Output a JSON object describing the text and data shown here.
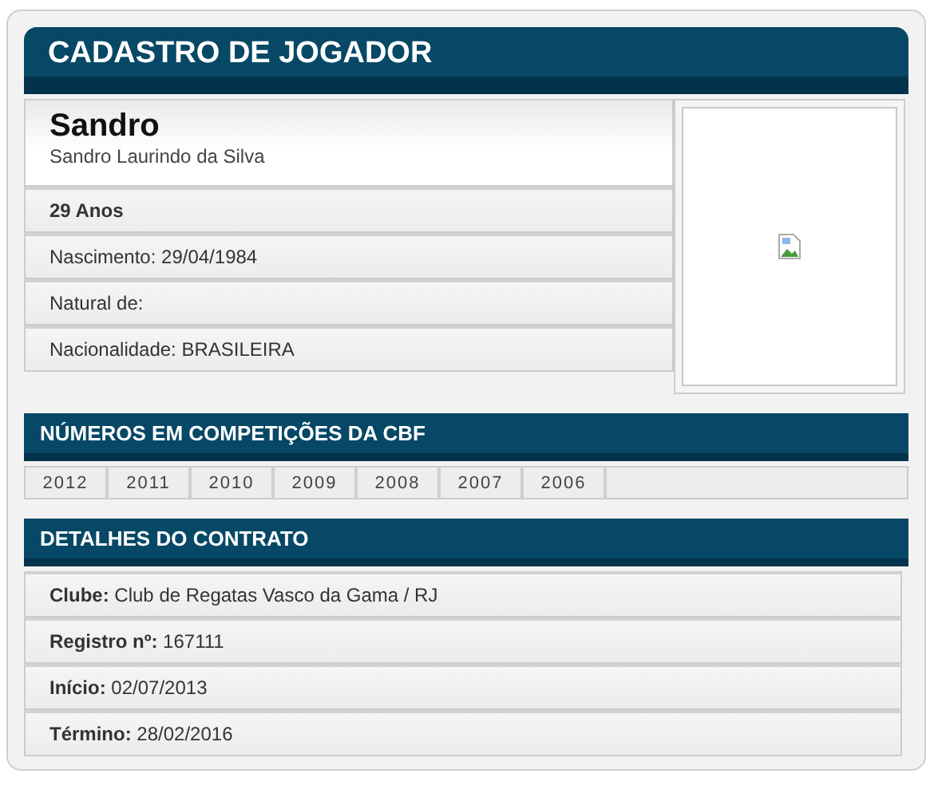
{
  "title": "CADASTRO DE JOGADOR",
  "player": {
    "name": "Sandro",
    "full_name": "Sandro Laurindo da Silva",
    "details": [
      {
        "kind": "strong",
        "text": "29 Anos"
      },
      {
        "kind": "plain",
        "text": "Nascimento: 29/04/1984"
      },
      {
        "kind": "plain",
        "text": "Natural de:"
      },
      {
        "kind": "plain",
        "text": "Nacionalidade: BRASILEIRA"
      }
    ]
  },
  "competitions": {
    "title": "NÚMEROS EM COMPETIÇÕES DA CBF",
    "years": [
      "2012",
      "2011",
      "2010",
      "2009",
      "2008",
      "2007",
      "2006"
    ]
  },
  "contract": {
    "title": "DETALHES DO CONTRATO",
    "rows": [
      "**Clube:** Club de Regatas Vasco da Gama / RJ",
      "**Registro nº:** 167111",
      "**Início:** 02/07/2013",
      "**Término:** 28/02/2016"
    ]
  }
}
